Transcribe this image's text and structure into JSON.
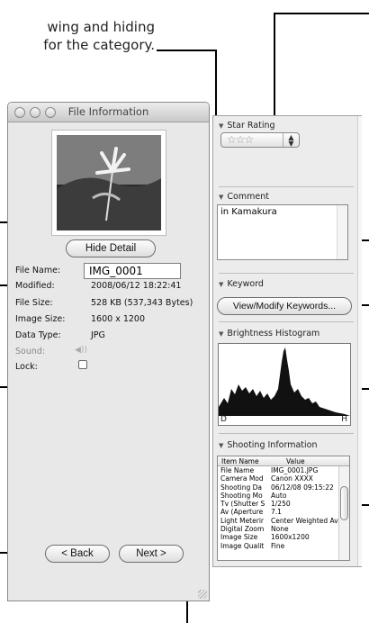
{
  "caption": {
    "line1": "wing and hiding",
    "line2": "for the category."
  },
  "window": {
    "title": "File Information",
    "hide_detail_label": "Hide Detail",
    "back_label": "< Back",
    "next_label": "Next >",
    "filename_value": "IMG_0001",
    "fields": [
      {
        "label": "File Name:",
        "value": ""
      },
      {
        "label": "Modified:",
        "value": "2008/06/12 18:22:41"
      },
      {
        "label": "File Size:",
        "value": "528 KB (537,343 Bytes)"
      },
      {
        "label": "Image Size:",
        "value": "1600 x 1200"
      },
      {
        "label": "Data Type:",
        "value": "JPG"
      },
      {
        "label": "Sound:",
        "value": ""
      },
      {
        "label": "Lock:",
        "value": ""
      }
    ]
  },
  "panel": {
    "star_rating": {
      "title": "Star Rating",
      "stars": "☆☆☆"
    },
    "comment": {
      "title": "Comment",
      "text": "in Kamakura"
    },
    "keyword": {
      "title": "Keyword",
      "button_label": "View/Modify Keywords..."
    },
    "histogram": {
      "title": "Brightness Histogram",
      "left": "D",
      "right": "H"
    },
    "shooting": {
      "title": "Shooting Information",
      "col_name": "Item Name",
      "col_value": "Value",
      "rows": [
        {
          "k": "File Name",
          "v": "IMG_0001.JPG"
        },
        {
          "k": "Camera Mod",
          "v": "Canon XXXX"
        },
        {
          "k": "Shooting Da",
          "v": "06/12/08 09:15:22"
        },
        {
          "k": "Shooting Mo",
          "v": "Auto"
        },
        {
          "k": "Tv (Shutter S",
          "v": "1/250"
        },
        {
          "k": "Av (Aperture",
          "v": "7.1"
        },
        {
          "k": "Light Meterir",
          "v": "Center Weighted Avg."
        },
        {
          "k": "Digital Zoom",
          "v": "None"
        },
        {
          "k": "Image Size",
          "v": "1600x1200"
        },
        {
          "k": "Image Qualit",
          "v": "Fine"
        }
      ]
    }
  },
  "colors": {
    "callout": "#000000",
    "window_bg": "#e8e8e8",
    "panel_bg": "#ececec"
  }
}
